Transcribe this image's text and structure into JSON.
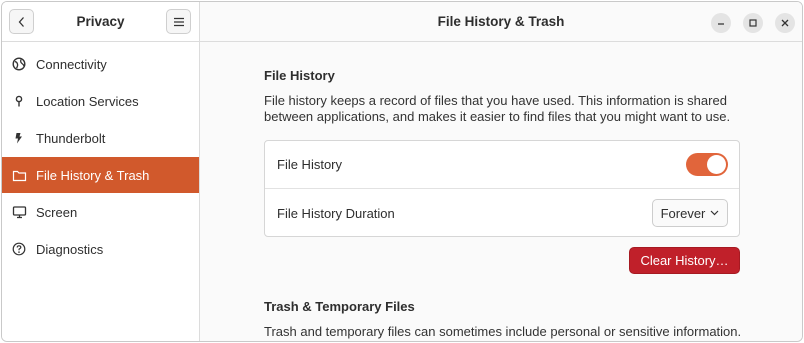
{
  "sidebar": {
    "title": "Privacy",
    "items": [
      {
        "label": "Connectivity",
        "icon": "globe-icon"
      },
      {
        "label": "Location Services",
        "icon": "location-pin-icon"
      },
      {
        "label": "Thunderbolt",
        "icon": "thunderbolt-icon"
      },
      {
        "label": "File History & Trash",
        "icon": "folder-icon",
        "active": true
      },
      {
        "label": "Screen",
        "icon": "monitor-icon"
      },
      {
        "label": "Diagnostics",
        "icon": "help-icon"
      }
    ]
  },
  "header": {
    "title": "File History & Trash"
  },
  "file_history": {
    "section_title": "File History",
    "description": "File history keeps a record of files that you have used. This information is shared between applications, and makes it easier to find files that you might want to use.",
    "toggle_label": "File History",
    "toggle_on": true,
    "duration_label": "File History Duration",
    "duration_value": "Forever",
    "clear_button": "Clear History…"
  },
  "trash": {
    "section_title": "Trash & Temporary Files",
    "description": "Trash and temporary files can sometimes include personal or sensitive information."
  },
  "colors": {
    "accent": "#d1592c",
    "toggle": "#e1653b",
    "destructive": "#c0202a"
  }
}
